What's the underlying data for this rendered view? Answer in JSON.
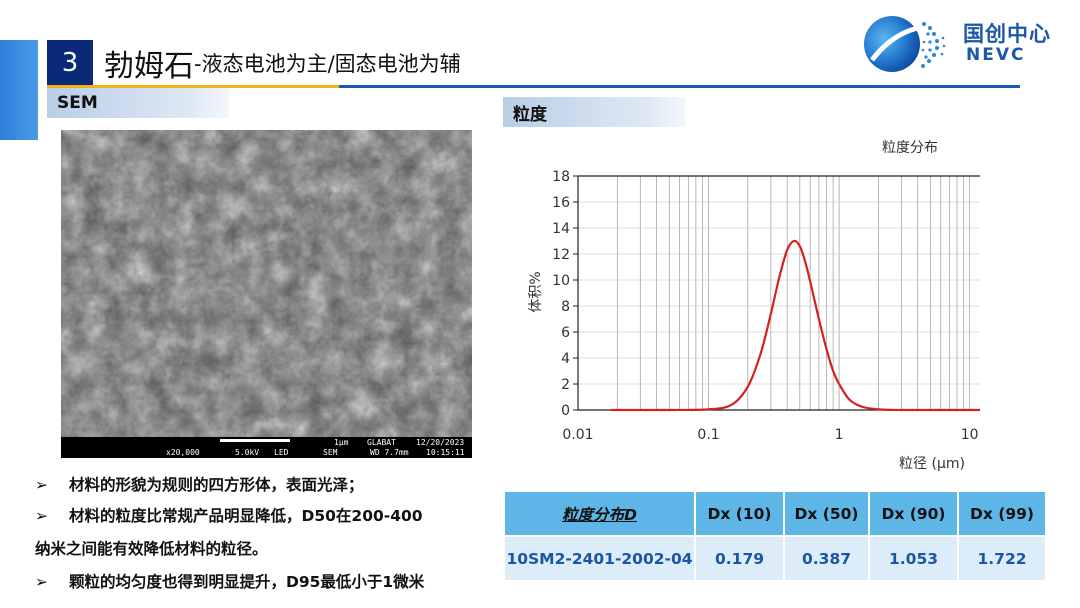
{
  "header": {
    "section_number": "3",
    "title_main": "勃姆石",
    "title_sub": "-液态电池为主/固态电池为辅"
  },
  "logo": {
    "name_cn": "国创中心",
    "name_en": "NEVC"
  },
  "sem": {
    "tag": "SEM",
    "info": {
      "magnification": "x20,000",
      "voltage": "5.0kV",
      "detector": "LED",
      "scale": "1μm",
      "mode": "SEM",
      "org": "GLABAT",
      "wd": "WD 7.7mm",
      "date": "12/20/2023",
      "time": "10:15:11"
    }
  },
  "bullets": [
    {
      "arrow": "➢",
      "text": "材料的形貌为规则的四方形体，表面光泽；"
    },
    {
      "arrow": "➢",
      "text": "材料的粒度比常规产品明显降低，D50在200-400"
    },
    {
      "arrow": "",
      "text": "纳米之间能有效降低材料的粒径。"
    },
    {
      "arrow": "➢",
      "text": "颗粒的均匀度也得到明显提升，D95最低小于1微米"
    }
  ],
  "psd": {
    "tag": "粒度"
  },
  "chart_data": {
    "type": "line",
    "title": "粒度分布",
    "xlabel": "粒径 (μm)",
    "ylabel": "体积%",
    "x_scale": "log",
    "xlim": [
      0.01,
      12
    ],
    "ylim": [
      0,
      18
    ],
    "x_ticks": [
      "0.01",
      "0.1",
      "1",
      "10"
    ],
    "y_ticks": [
      "0",
      "2",
      "4",
      "6",
      "8",
      "10",
      "12",
      "14",
      "16",
      "18"
    ],
    "grid": true,
    "series_color": "#d42020",
    "x": [
      0.018,
      0.05,
      0.1,
      0.15,
      0.2,
      0.25,
      0.3,
      0.35,
      0.4,
      0.45,
      0.5,
      0.55,
      0.6,
      0.7,
      0.8,
      0.9,
      1.0,
      1.2,
      1.5,
      2.0,
      3.0,
      5.0,
      12.0
    ],
    "y": [
      0,
      0,
      0.05,
      0.4,
      1.8,
      4.3,
      7.4,
      10.3,
      12.3,
      13.0,
      12.6,
      11.4,
      9.9,
      7.0,
      4.7,
      3.0,
      2.0,
      0.8,
      0.25,
      0.05,
      0,
      0,
      0
    ]
  },
  "table": {
    "headers": [
      "粒度分布D",
      "Dx (10)",
      "Dx (50)",
      "Dx (90)",
      "Dx (99)"
    ],
    "rows": [
      [
        "10SM2-2401-2002-04",
        "0.179",
        "0.387",
        "1.053",
        "1.722"
      ]
    ]
  }
}
